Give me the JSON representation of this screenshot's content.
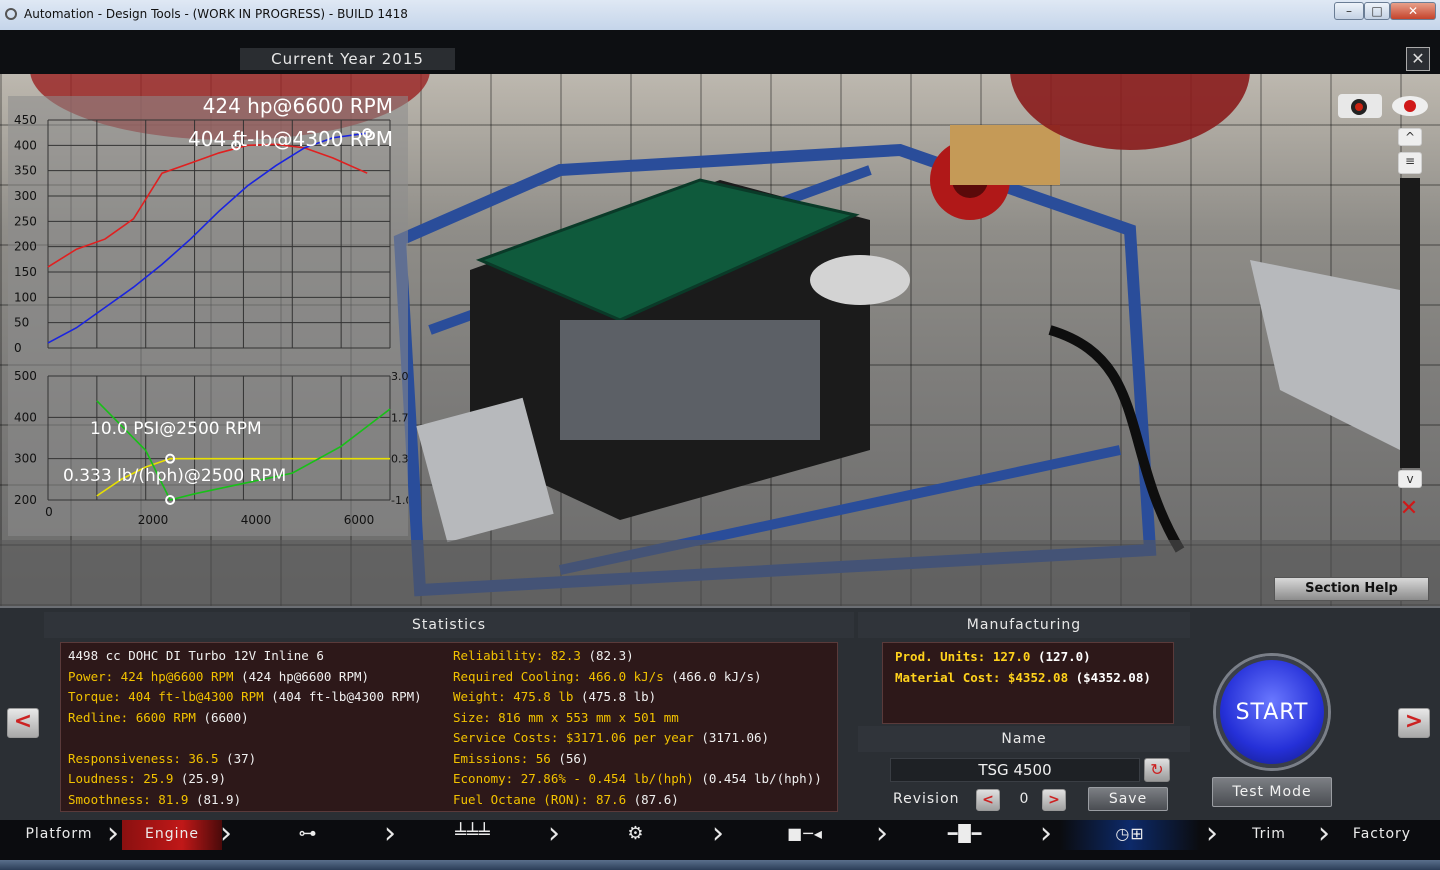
{
  "window": {
    "title": "Automation - Design Tools - (WORK IN PROGRESS) - BUILD 1418"
  },
  "header": {
    "current_year": "Current Year 2015"
  },
  "chart_data": [
    {
      "type": "line",
      "title": "424 hp@6600 RPM",
      "subtitle": "404 ft-lb@4300 RPM",
      "ylim": [
        0,
        450
      ],
      "yticks": [
        "450",
        "400",
        "350",
        "300",
        "250",
        "200",
        "150",
        "100",
        "50",
        "0"
      ],
      "xlim": [
        1000,
        7000
      ],
      "grid": true,
      "series": [
        {
          "color": "#e02020",
          "x": [
            1000,
            1500,
            2000,
            2500,
            3000,
            3500,
            4000,
            4500,
            5000,
            5500,
            6000,
            6600
          ],
          "values": [
            160,
            195,
            215,
            255,
            345,
            365,
            385,
            400,
            402,
            395,
            375,
            345
          ]
        },
        {
          "color": "#1a24e0",
          "x": [
            1000,
            1500,
            2000,
            2500,
            3000,
            3500,
            4000,
            4500,
            5000,
            5500,
            6000,
            6600
          ],
          "values": [
            10,
            40,
            80,
            120,
            165,
            215,
            270,
            320,
            360,
            395,
            415,
            424
          ]
        }
      ]
    },
    {
      "type": "line",
      "title": "10.0 PSI@2500 RPM",
      "subtitle": "0.333 lb/(hph)@2500 RPM",
      "ylim": [
        200,
        500
      ],
      "yticks": [
        "500",
        "400",
        "300",
        "200"
      ],
      "y2ticks": [
        "3.0",
        "1.7",
        "0.3",
        "-1.0"
      ],
      "xticks": [
        "0",
        "2000",
        "4000",
        "6000"
      ],
      "xlim": [
        0,
        7000
      ],
      "grid": true,
      "series": [
        {
          "color": "#e8e000",
          "x": [
            1000,
            1500,
            2000,
            2500,
            3000,
            4000,
            5000,
            6000,
            7000
          ],
          "values": [
            210,
            250,
            280,
            300,
            300,
            300,
            300,
            300,
            300
          ]
        },
        {
          "color": "#18c018",
          "x": [
            1000,
            1500,
            2000,
            2500,
            3000,
            4000,
            5000,
            6000,
            7000
          ],
          "values": [
            440,
            380,
            320,
            200,
            215,
            240,
            265,
            330,
            420
          ]
        }
      ]
    }
  ],
  "view": {
    "section_help": "Section Help",
    "up_icon": "chevron-up-icon",
    "down_icon": "chevron-down-icon"
  },
  "statistics": {
    "header": "Statistics",
    "left": [
      {
        "label": "4498 cc DOHC DI Turbo 12V Inline 6",
        "value": ""
      },
      {
        "label": "Power: 424 hp@6600 RPM",
        "value": " (424 hp@6600 RPM)"
      },
      {
        "label": "Torque: 404 ft-lb@4300 RPM",
        "value": " (404 ft-lb@4300 RPM)"
      },
      {
        "label": "Redline: 6600 RPM",
        "value": " (6600)"
      },
      {
        "label": "Responsiveness: 36.5",
        "value": " (37)"
      },
      {
        "label": "Loudness: 25.9",
        "value": " (25.9)"
      },
      {
        "label": "Smoothness: 81.9",
        "value": " (81.9)"
      }
    ],
    "right": [
      {
        "label": "Reliability: 82.3",
        "value": " (82.3)"
      },
      {
        "label": "Required Cooling: 466.0 kJ/s",
        "value": " (466.0 kJ/s)"
      },
      {
        "label": "Weight: 475.8 lb",
        "value": " (475.8 lb)"
      },
      {
        "label": "Size: 816 mm x 553 mm x 501 mm",
        "value": ""
      },
      {
        "label": "Service Costs: $3171.06 per year",
        "value": " (3171.06)"
      },
      {
        "label": "Emissions: 56",
        "value": " (56)"
      },
      {
        "label": "Economy: 27.86% - 0.454 lb/(hph)",
        "value": " (0.454 lb/(hph))"
      },
      {
        "label": "Fuel Octane (RON): 87.6",
        "value": " (87.6)"
      }
    ]
  },
  "manufacturing": {
    "header": "Manufacturing",
    "units_label": "Prod. Units: 127.0",
    "units_value": " (127.0)",
    "cost_label": "Material Cost: $4352.08",
    "cost_value": " ($4352.08)"
  },
  "name_panel": {
    "header": "Name",
    "name_value": "TSG 4500",
    "revision_label": "Revision",
    "revision_value": "0",
    "save": "Save"
  },
  "actions": {
    "start": "START",
    "test_mode": "Test Mode"
  },
  "nav": {
    "platform": "Platform",
    "engine": "Engine",
    "trim": "Trim",
    "factory": "Factory"
  }
}
